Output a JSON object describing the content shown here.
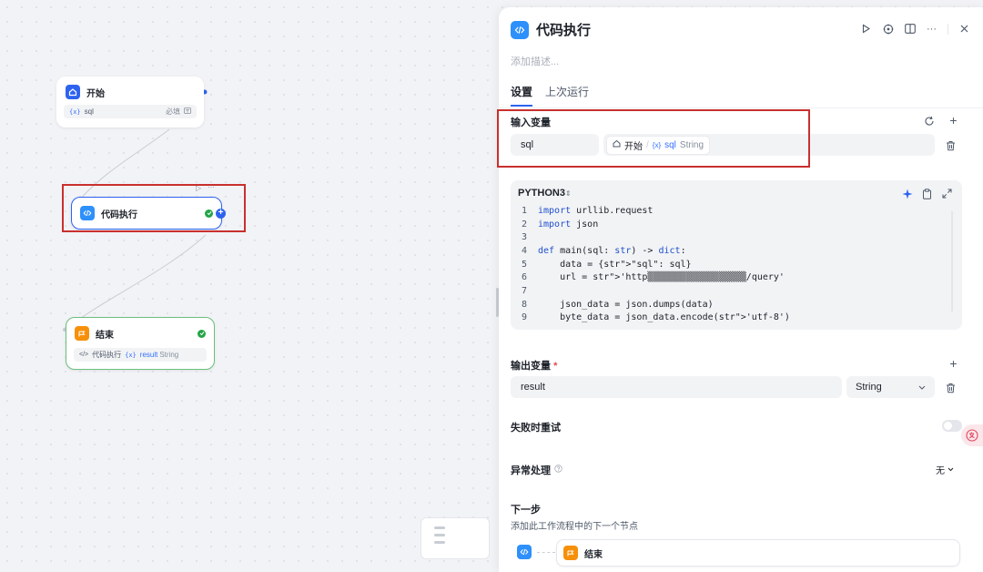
{
  "canvas": {
    "start_node": {
      "title": "开始",
      "var_name": "sql",
      "required_label": "必填"
    },
    "code_node": {
      "title": "代码执行"
    },
    "end_node": {
      "title": "结束",
      "ref_source": "代码执行",
      "ref_var": "result",
      "ref_type": "String"
    }
  },
  "panel": {
    "title": "代码执行",
    "description_placeholder": "添加描述...",
    "tabs": [
      {
        "label": "设置",
        "active": true
      },
      {
        "label": "上次运行",
        "active": false
      }
    ],
    "input_section": {
      "title": "输入变量",
      "variable": {
        "name": "sql",
        "source_node": "开始",
        "source_var": "sql",
        "source_type": "String"
      }
    },
    "code": {
      "language": "PYTHON3",
      "lines": [
        {
          "n": "1",
          "text": "import urllib.request"
        },
        {
          "n": "2",
          "text": "import json"
        },
        {
          "n": "3",
          "text": ""
        },
        {
          "n": "4",
          "text": "def main(sql: str) -> dict:"
        },
        {
          "n": "5",
          "text": "    data = {\"sql\": sql}"
        },
        {
          "n": "6",
          "text": "    url = 'http▒▒▒▒▒▒▒▒▒▒▒▒▒▒▒▒▒▒/query'"
        },
        {
          "n": "7",
          "text": ""
        },
        {
          "n": "8",
          "text": "    json_data = json.dumps(data)"
        },
        {
          "n": "9",
          "text": "    byte_data = json_data.encode('utf-8')"
        }
      ]
    },
    "output_section": {
      "title": "输出变量",
      "required_mark": "*",
      "variable": {
        "name": "result",
        "type": "String"
      }
    },
    "retry_label": "失败时重试",
    "exception": {
      "label": "异常处理",
      "value": "无"
    },
    "next_step": {
      "title": "下一步",
      "description": "添加此工作流程中的下一个节点",
      "target": "结束"
    }
  },
  "colors": {
    "accent_blue": "#2e90fa",
    "end_orange": "#f79009",
    "annotation_red": "#c8302f",
    "success_green": "#22a447"
  }
}
